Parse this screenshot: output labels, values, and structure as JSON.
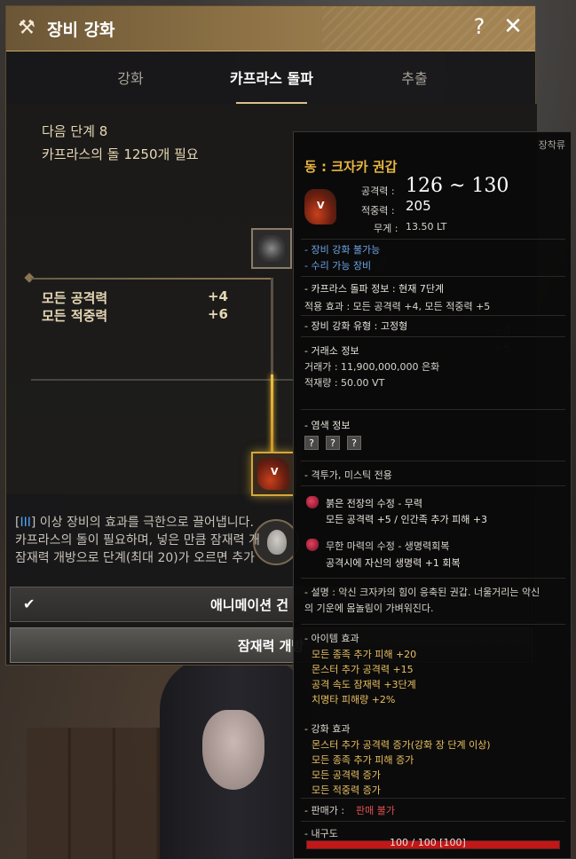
{
  "window": {
    "title": "장비 강화",
    "help": "?",
    "close": "✕"
  },
  "tabs": [
    {
      "label": "강화"
    },
    {
      "label": "카프라스 돌파"
    },
    {
      "label": "추출"
    }
  ],
  "panel": {
    "next_step": "다음 단계 8",
    "requirement": "카프라스의 돌 1250개 필요",
    "stats": [
      {
        "label": "모든 공격력",
        "value": "+4"
      },
      {
        "label": "모든 적중력",
        "value": "+6"
      }
    ],
    "description": [
      {
        "prefix": "[",
        "highlight": "III",
        "suffix": "] 이상 장비의 효과를 극한으로 끌어냅니다."
      },
      {
        "text": "카프라스의 돌이 필요하며, 넣은 만큼 잠재력 개"
      },
      {
        "text": "잠재력 개방으로 단계(최대 20)가 오르면 추가 "
      }
    ],
    "animation_label": "애니메이션 건",
    "potential_label": "잠재력 개방"
  },
  "tooltip": {
    "equip_type": "장착류",
    "item_name": "동 : 크자카 권갑",
    "attack_label": "공격력 :",
    "attack_value": "126 ~ 130",
    "accuracy_label": "적중력 :",
    "accuracy_value": "205",
    "weight_label": "무게 :",
    "weight_value": "13.50 LT",
    "enhance_unavailable": "- 장비 강화 불가능",
    "repair_available": "- 수리 가능 장비",
    "caphras_info": "- 카프라스 돌파 정보 : 현재 7단계",
    "caphras_effect": "적용 효과 : 모든 공격력 +4, 모든 적중력 +5",
    "enhance_type": "- 장비 강화 유형 : 고정형",
    "market_title": "- 거래소 정보",
    "market_price": "거래가 : 11,900,000,000 은화",
    "market_stock": "적재량 : 50.00 VT",
    "dye_title": "- 염색 정보",
    "dye_slots": [
      "?",
      "?",
      "?"
    ],
    "class_restrict": "- 격투가, 미스틱 전용",
    "crystal1_name": "붉은 전장의 수정 - 무력",
    "crystal1_effect": "모든 공격력 +5 / 인간족 추가 피해 +3",
    "crystal2_name": "무한 마력의 수정 - 생명력회복",
    "crystal2_effect": "공격시에 자신의 생명력 +1 회복",
    "lore_1": "- 설명 : 악신 크자카의 힘이 응축된 권갑. 너울거리는 악신",
    "lore_2": "의 기운에 몸놀림이 가벼워진다.",
    "item_effect_title": "- 아이템 효과",
    "item_effects": [
      "모든 종족 추가 피해 +20",
      "몬스터 추가 공격력 +15",
      "공격 속도 잠재력 +3단계",
      "치명타 피해량 +2%"
    ],
    "enhance_effect_title": "- 강화 효과",
    "enhance_effects": [
      "몬스터 추가 공격력 증가(강화 장 단계 이상)",
      "모든 종족 추가 피해 증가",
      "모든 공격력 증가",
      "모든 적중력 증가"
    ],
    "sell_label": "- 판매가 :",
    "sell_value": "판매 불가",
    "durability_label": "- 내구도",
    "durability_text": "100 / 100 [100]",
    "durability": 1.0
  },
  "ghost": {
    "level": "7",
    "stat1": "+4",
    "stat2": "+5"
  },
  "colors": {
    "title_bar": "#9e8050",
    "item_name": "#e8b640",
    "info_blue": "#6fa4e8",
    "effect_gold": "#e8c060",
    "unsellable_red": "#e05050",
    "durability_red": "#c01818"
  }
}
